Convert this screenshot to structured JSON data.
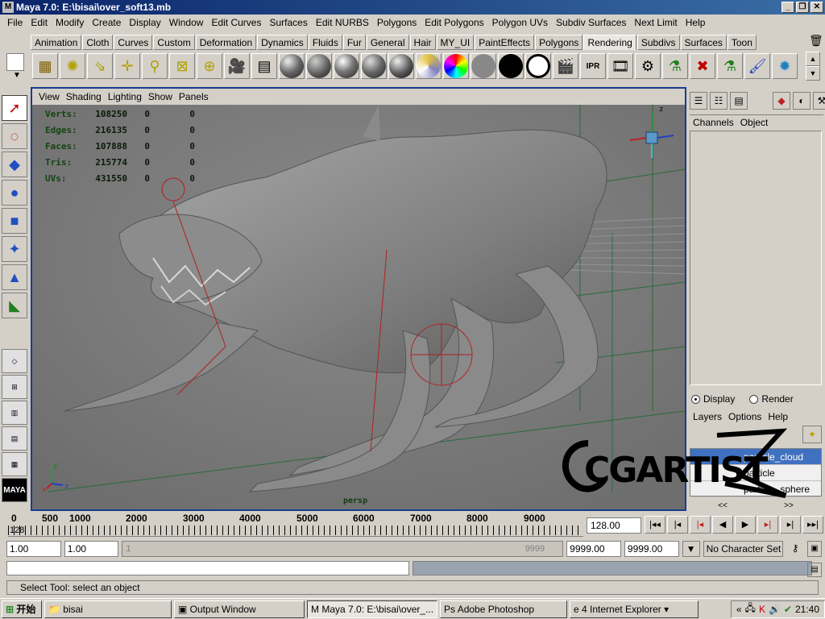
{
  "window": {
    "title": "Maya 7.0: E:\\bisai\\over_soft13.mb",
    "app_icon_letter": "M"
  },
  "menus": [
    "File",
    "Edit",
    "Modify",
    "Create",
    "Display",
    "Window",
    "Edit Curves",
    "Surfaces",
    "Edit NURBS",
    "Polygons",
    "Edit Polygons",
    "Polygon UVs",
    "Subdiv Surfaces",
    "Next Limit",
    "Help"
  ],
  "shelf_tabs": [
    "Animation",
    "Cloth",
    "Curves",
    "Custom",
    "Deformation",
    "Dynamics",
    "Fluids",
    "Fur",
    "General",
    "Hair",
    "MY_UI",
    "PaintEffects",
    "Polygons",
    "Rendering",
    "Subdivs",
    "Surfaces",
    "Toon"
  ],
  "shelf_active_tab": "Rendering",
  "viewport": {
    "menus": [
      "View",
      "Shading",
      "Lighting",
      "Show",
      "Panels"
    ],
    "stats": [
      {
        "label": "Verts:",
        "v1": "108250",
        "v2": "0",
        "v3": "0"
      },
      {
        "label": "Edges:",
        "v1": "216135",
        "v2": "0",
        "v3": "0"
      },
      {
        "label": "Faces:",
        "v1": "107888",
        "v2": "0",
        "v3": "0"
      },
      {
        "label": "Tris:",
        "v1": "215774",
        "v2": "0",
        "v3": "0"
      },
      {
        "label": "UVs:",
        "v1": "431550",
        "v2": "0",
        "v3": "0"
      }
    ],
    "camera_label": "persp"
  },
  "channel_box": {
    "menus": [
      "Channels",
      "Object"
    ],
    "display_mode": {
      "display": "Display",
      "render": "Render",
      "selected": "display"
    },
    "layer_menus": [
      "Layers",
      "Options",
      "Help"
    ],
    "layers": [
      {
        "name": "particle_cloud",
        "selected": true
      },
      {
        "name": "particle",
        "selected": false
      },
      {
        "name": "particle_sphere",
        "selected": false
      }
    ],
    "arrows": [
      "<<",
      ">>"
    ]
  },
  "timeline": {
    "ticks": [
      "0",
      "500",
      "1000",
      "2000",
      "3000",
      "4000",
      "5000",
      "6000",
      "7000",
      "8000",
      "9000"
    ],
    "current_frame_marker": "128",
    "current_time": "128.00"
  },
  "range": {
    "start_time": "1.00",
    "playback_start": "1.00",
    "slider_start": "1",
    "slider_end": "9999",
    "playback_end": "9999.00",
    "end_time": "9999.00",
    "character_set": "No Character Set"
  },
  "help_line": "Select Tool: select an object",
  "taskbar": {
    "start": "开始",
    "items": [
      "bisai",
      "Output Window",
      "Maya 7.0: E:\\bisai\\over_...",
      "Adobe Photoshop",
      "4 Internet Explorer"
    ],
    "active_index": 2,
    "clock": "21:40"
  },
  "watermark": "CGARTIST"
}
